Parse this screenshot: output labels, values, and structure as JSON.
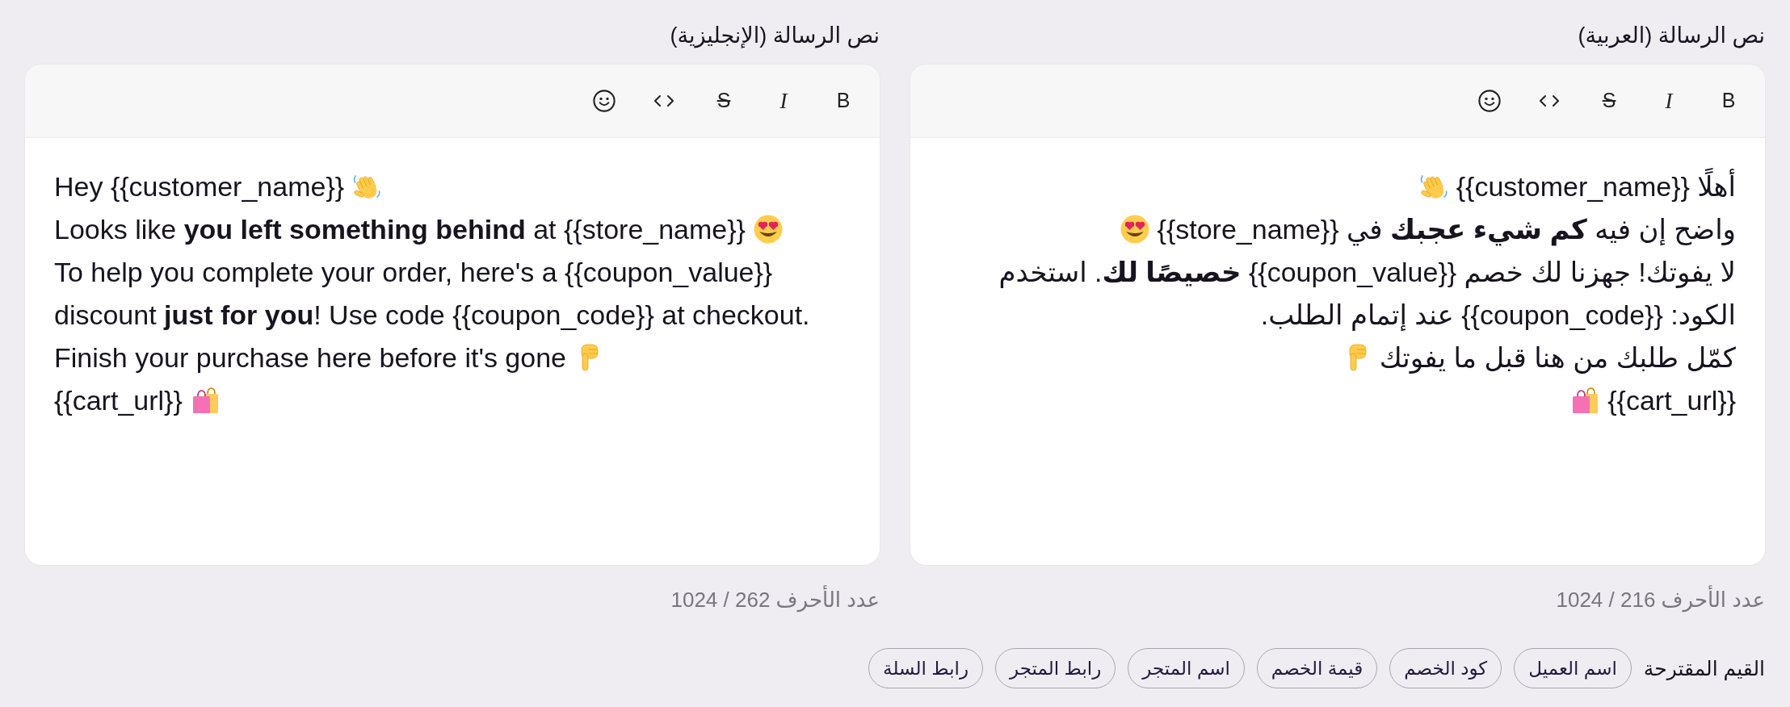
{
  "editors": [
    {
      "label": "نص الرسالة (العربية)",
      "kind": "rtl",
      "toolbar": [
        {
          "kind": "bold",
          "glyph": "B"
        },
        {
          "kind": "italic",
          "glyph": "I"
        },
        {
          "kind": "strike",
          "glyph": "S"
        },
        {
          "kind": "code"
        },
        {
          "kind": "emoji"
        }
      ],
      "lines": [
        {
          "kind": "wave",
          "text": "أهلًا {{customer_name}}"
        },
        {
          "kind": "hearteyes",
          "text": "واضح إن فيه **كم شيء عجبك** في {{store_name}}"
        },
        {
          "kind": "plain",
          "text": "لا يفوتك! جهزنا لك خصم {{coupon_value}} **خصيصًا لك**. استخدم"
        },
        {
          "kind": "plain",
          "text": "الكود: {{coupon_code}} عند إتمام الطلب."
        },
        {
          "kind": "pointdown",
          "text": "كمّل طلبك من هنا قبل ما يفوتك"
        },
        {
          "kind": "bags",
          "text": "{{cart_url}}"
        }
      ],
      "counter": "عدد الأحرف 216 / 1024"
    },
    {
      "label": "نص الرسالة (الإنجليزية)",
      "kind": "ltr",
      "toolbar": [
        {
          "kind": "bold",
          "glyph": "B"
        },
        {
          "kind": "italic",
          "glyph": "I"
        },
        {
          "kind": "strike",
          "glyph": "S"
        },
        {
          "kind": "code"
        },
        {
          "kind": "emoji"
        }
      ],
      "lines": [
        {
          "kind": "wave",
          "text": "Hey {{customer_name}}"
        },
        {
          "kind": "hearteyes",
          "text": "Looks like **you left something behind** at {{store_name}}"
        },
        {
          "kind": "plain",
          "text": "To help you complete your order, here's a {{coupon_value}}"
        },
        {
          "kind": "plain",
          "text": "discount **just for you**! Use code {{coupon_code}} at checkout."
        },
        {
          "kind": "pointdown",
          "text": "Finish your purchase here before it's gone"
        },
        {
          "kind": "bags",
          "text": "{{cart_url}}"
        }
      ],
      "counter": "عدد الأحرف 262 / 1024"
    }
  ],
  "suggestions": {
    "label": "القيم المقترحة",
    "chips": [
      "اسم العميل",
      "كود الخصم",
      "قيمة الخصم",
      "اسم المتجر",
      "رابط المتجر",
      "رابط السلة"
    ]
  }
}
